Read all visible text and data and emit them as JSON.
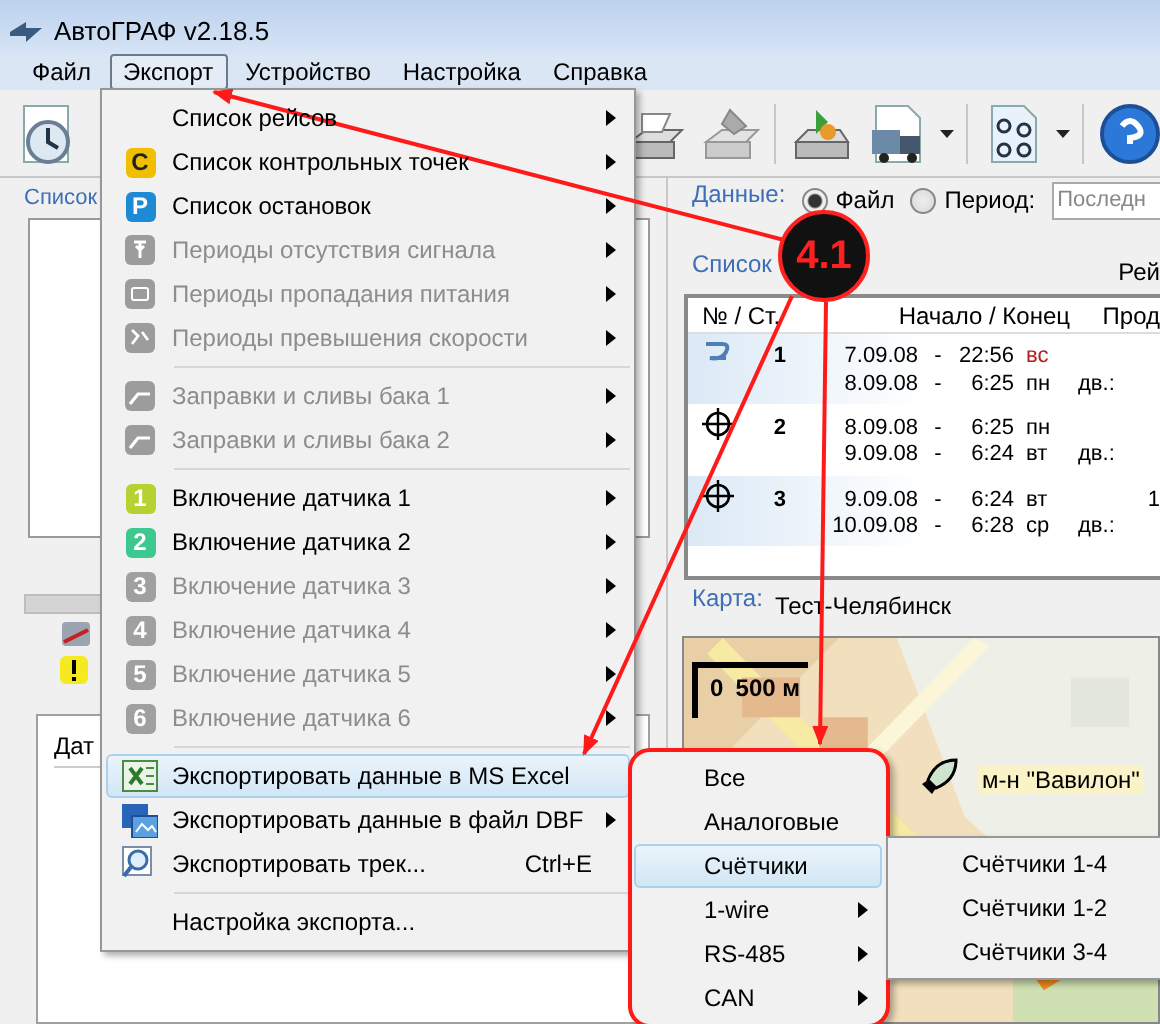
{
  "window": {
    "title": "АвтоГРАФ v2.18.5"
  },
  "menu_bar": [
    {
      "label": "Файл",
      "selected": false
    },
    {
      "label": "Экспорт",
      "selected": true
    },
    {
      "label": "Устройство",
      "selected": false
    },
    {
      "label": "Настройка",
      "selected": false
    },
    {
      "label": "Справка",
      "selected": false
    }
  ],
  "left_panel": {
    "tab": "Список",
    "column_1": "Дат"
  },
  "data_source": {
    "label": "Данные:",
    "options": [
      {
        "label": "Файл",
        "selected": true
      },
      {
        "label": "Период:",
        "selected": false
      }
    ],
    "period_value": "Последн"
  },
  "trips": {
    "label": "Список",
    "column_label": "Рей",
    "columns": [
      "№ / Ст.",
      "Начало / Конец",
      "Прод"
    ],
    "rows": [
      {
        "kind": "move",
        "number": "1",
        "start": {
          "date": "7.09.08",
          "dash": "-",
          "time": "22:56",
          "day": "вс",
          "weekend": true
        },
        "end": {
          "date": "8.09.08",
          "dash": "-",
          "time": "6:25",
          "day": "пн",
          "weekend": false
        },
        "end_note": "дв.:"
      },
      {
        "kind": "stop",
        "number": "2",
        "start": {
          "date": "8.09.08",
          "dash": "-",
          "time": "6:25",
          "day": "пн",
          "weekend": false
        },
        "end": {
          "date": "9.09.08",
          "dash": "-",
          "time": "6:24",
          "day": "вт",
          "weekend": false
        },
        "end_note": "дв.:"
      },
      {
        "kind": "stop",
        "number": "3",
        "start": {
          "date": "9.09.08",
          "dash": "-",
          "time": "6:24",
          "day": "вт",
          "weekend": false
        },
        "end": {
          "date": "10.09.08",
          "dash": "-",
          "time": "6:28",
          "day": "ср",
          "weekend": false
        },
        "end_note": "дв.:",
        "duration": "1"
      }
    ]
  },
  "map": {
    "label": "Карта:",
    "name": "Тест-Челябинск",
    "scale_start": "0",
    "scale_end": "500 м",
    "marker_label": "м-н \"Вавилон\""
  },
  "export_menu": [
    {
      "kind": "plain",
      "label": "Список рейсов",
      "disabled": false,
      "submenu": true,
      "highlighted": false
    },
    {
      "kind": "badge",
      "badge": "C",
      "color": "#f0c000",
      "label": "Список контрольных точек",
      "disabled": false,
      "submenu": true,
      "highlighted": false
    },
    {
      "kind": "badge",
      "badge": "P",
      "color": "#1e8ad6",
      "label": "Список остановок",
      "disabled": false,
      "submenu": true,
      "highlighted": false
    },
    {
      "kind": "signal",
      "label": "Периоды отсутствия сигнала",
      "disabled": true,
      "submenu": true,
      "highlighted": false
    },
    {
      "kind": "power",
      "label": "Периоды пропадания питания",
      "disabled": true,
      "submenu": true,
      "highlighted": false
    },
    {
      "kind": "speed",
      "label": "Периоды превышения скорости",
      "disabled": true,
      "submenu": true,
      "highlighted": false
    },
    {
      "kind": "separator"
    },
    {
      "kind": "tank",
      "label": "Заправки и сливы бака 1",
      "disabled": true,
      "submenu": true,
      "highlighted": false
    },
    {
      "kind": "tank",
      "label": "Заправки и сливы бака 2",
      "disabled": true,
      "submenu": true,
      "highlighted": false
    },
    {
      "kind": "separator"
    },
    {
      "kind": "badge",
      "badge": "1",
      "color": "#b4d232",
      "label": "Включение датчика 1",
      "disabled": false,
      "submenu": true,
      "highlighted": false
    },
    {
      "kind": "badge",
      "badge": "2",
      "color": "#3cc88e",
      "label": "Включение датчика 2",
      "disabled": false,
      "submenu": true,
      "highlighted": false
    },
    {
      "kind": "badge",
      "badge": "3",
      "color": "#a0a0a0",
      "label": "Включение датчика 3",
      "disabled": true,
      "submenu": true,
      "highlighted": false
    },
    {
      "kind": "badge",
      "badge": "4",
      "color": "#a0a0a0",
      "label": "Включение датчика 4",
      "disabled": true,
      "submenu": true,
      "highlighted": false
    },
    {
      "kind": "badge",
      "badge": "5",
      "color": "#a0a0a0",
      "label": "Включение датчика 5",
      "disabled": true,
      "submenu": true,
      "highlighted": false
    },
    {
      "kind": "badge",
      "badge": "6",
      "color": "#a0a0a0",
      "label": "Включение датчика 6",
      "disabled": true,
      "submenu": true,
      "highlighted": false
    },
    {
      "kind": "separator"
    },
    {
      "kind": "excel",
      "label": "Экспортировать данные в MS Excel",
      "disabled": false,
      "submenu": false,
      "highlighted": true
    },
    {
      "kind": "dbf",
      "label": "Экспортировать данные в файл DBF",
      "disabled": false,
      "submenu": true,
      "highlighted": false
    },
    {
      "kind": "track",
      "label": "Экспортировать трек...",
      "shortcut": "Ctrl+E",
      "disabled": false,
      "submenu": false,
      "highlighted": false
    },
    {
      "kind": "separator"
    },
    {
      "kind": "plain",
      "label": "Настройка экспорта...",
      "disabled": false,
      "submenu": false,
      "highlighted": false
    }
  ],
  "sensor_submenu": [
    {
      "label": "Все",
      "submenu": false,
      "highlighted": false
    },
    {
      "label": "Аналоговые",
      "submenu": false,
      "highlighted": false
    },
    {
      "label": "Счётчики",
      "submenu": false,
      "highlighted": true
    },
    {
      "label": "1-wire",
      "submenu": true,
      "highlighted": false
    },
    {
      "label": "RS-485",
      "submenu": true,
      "highlighted": false
    },
    {
      "label": "CAN",
      "submenu": true,
      "highlighted": false
    }
  ],
  "counter_submenu": [
    {
      "label": "Счётчики 1-4",
      "highlighted": false
    },
    {
      "label": "Счётчики 1-2",
      "highlighted": false
    },
    {
      "label": "Счётчики 3-4",
      "highlighted": false
    }
  ],
  "callout": {
    "label": "4.1"
  }
}
